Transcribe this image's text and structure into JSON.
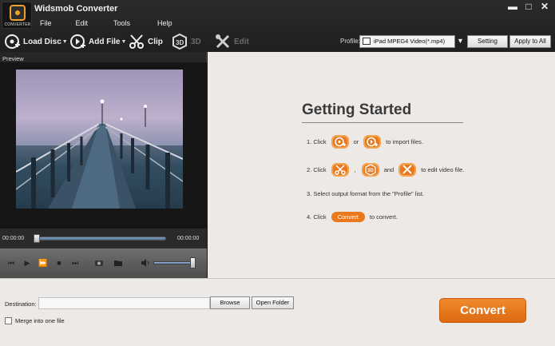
{
  "app": {
    "title": "Widsmob Converter",
    "logo_text": "CONVERTER",
    "window_buttons": {
      "minimize": "▬",
      "maximize": "□",
      "close": "✕"
    }
  },
  "menu": [
    "File",
    "Edit",
    "Tools",
    "Help"
  ],
  "toolbar": {
    "load_disc": "Load Disc",
    "add_file": "Add File",
    "clip": "Clip",
    "three_d": "3D",
    "edit": "Edit"
  },
  "profile": {
    "label": "Profile:",
    "value": "iPad MPEG4 Video(*.mp4)",
    "setting": "Setting",
    "apply_all": "Apply to All"
  },
  "preview": {
    "label": "Preview",
    "time_start": "00:00:00",
    "time_end": "00:00:00",
    "volume_level": 1.0
  },
  "getting_started": {
    "title": "Getting Started",
    "step1": {
      "prefix": "1. Click",
      "mid": "or",
      "suffix": "to import files."
    },
    "step2": {
      "prefix": "2. Click",
      "comma": ",",
      "and": "and",
      "suffix": "to edit video file."
    },
    "step3": "3. Select output format from the \"Profile\" list.",
    "step4": {
      "prefix": "4. Click",
      "button": "Convert",
      "suffix": "to convert."
    }
  },
  "bottom": {
    "destination_label": "Destination:",
    "destination_value": "",
    "browse": "Browse",
    "open_folder": "Open Folder",
    "merge_label": "Merge into one file",
    "merge_checked": false,
    "convert": "Convert"
  },
  "colors": {
    "accent": "#e8791e",
    "header": "#1f1f1f",
    "panel": "#ece9e6"
  }
}
